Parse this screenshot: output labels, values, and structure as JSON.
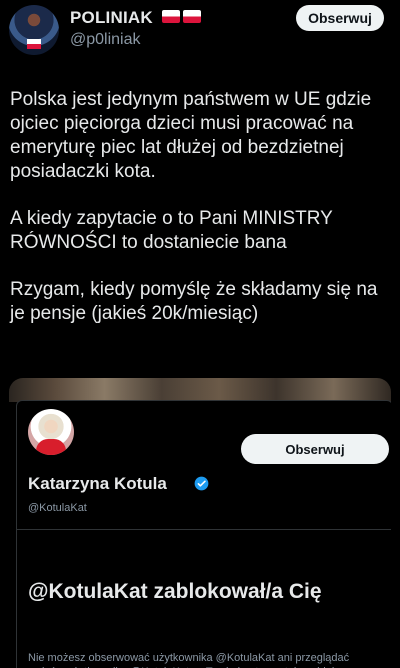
{
  "tweet": {
    "author": {
      "display_name": "POLINIAK",
      "flags": [
        "🇵🇱",
        "🇵🇱"
      ],
      "handle": "@p0liniak"
    },
    "follow_label": "Obserwuj",
    "paragraphs": [
      "Polska jest jedynym państwem w UE gdzie ojciec pięciorga dzieci musi pracować na emeryturę piec lat dłużej od bezdzietnej posiadaczki kota.",
      "A kiedy zapytacie o to Pani MINISTRY RÓWNOŚCI to dostaniecie bana",
      "Rzygam, kiedy pomyślę że składamy się na je pensje (jakieś 20k/miesiąc)"
    ]
  },
  "embedded_screenshot": {
    "follow_label": "Obserwuj",
    "profile": {
      "name": "Katarzyna Kotula",
      "handle": "@KotulaKat"
    },
    "blocked_title": "@KotulaKat zablokował/a Cię",
    "blocked_description": "Nie możesz obserwować użytkownika @KotulaKat ani przeglądać wpisów użytkownika @KotulaKat — Twoje konto zostało zablokowane."
  },
  "colors": {
    "background": "#000000",
    "text": "#e7e9ea",
    "secondary_text": "#8b98a5",
    "button_bg": "#eff3f4",
    "verified": "#1d9bf0"
  }
}
